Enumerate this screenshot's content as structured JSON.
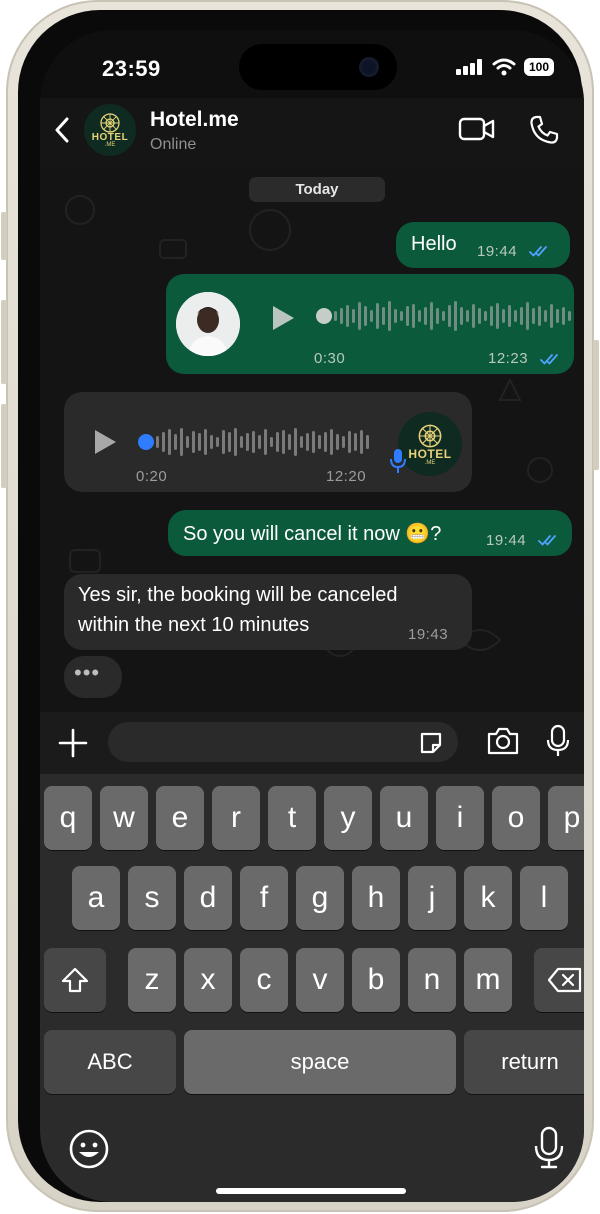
{
  "status_bar": {
    "time": "23:59",
    "battery": "100"
  },
  "header": {
    "contact_name": "Hotel.me",
    "contact_status": "Online",
    "avatar_logo": "HOTEL",
    "avatar_logo_sub": ".ME"
  },
  "chat": {
    "day_label": "Today",
    "messages": [
      {
        "type": "text",
        "direction": "out",
        "text": "Hello",
        "time": "19:44"
      },
      {
        "type": "voice",
        "direction": "out",
        "duration": "0:30",
        "time": "12:23"
      },
      {
        "type": "voice",
        "direction": "in",
        "duration": "0:20",
        "time": "12:20"
      },
      {
        "type": "text",
        "direction": "out",
        "text": "So you will cancel it now 😬?",
        "time": "19:44"
      },
      {
        "type": "text",
        "direction": "in",
        "text_line1": "Yes sir, the booking will be canceled",
        "text_line2": "within the next 10 minutes",
        "time": "19:43"
      },
      {
        "type": "typing",
        "direction": "in",
        "text": "•••"
      }
    ]
  },
  "keyboard": {
    "row1": [
      "q",
      "w",
      "e",
      "r",
      "t",
      "y",
      "u",
      "i",
      "o",
      "p"
    ],
    "row2": [
      "a",
      "s",
      "d",
      "f",
      "g",
      "h",
      "j",
      "k",
      "l"
    ],
    "row3": [
      "z",
      "x",
      "c",
      "v",
      "b",
      "n",
      "m"
    ],
    "abc": "ABC",
    "space": "space",
    "return": "return"
  },
  "colors": {
    "outgoing_bubble": "#0b5a3c",
    "incoming_bubble": "#2a2a2a",
    "read_ticks": "#4da3ff",
    "mic_accent": "#2f7cff"
  }
}
